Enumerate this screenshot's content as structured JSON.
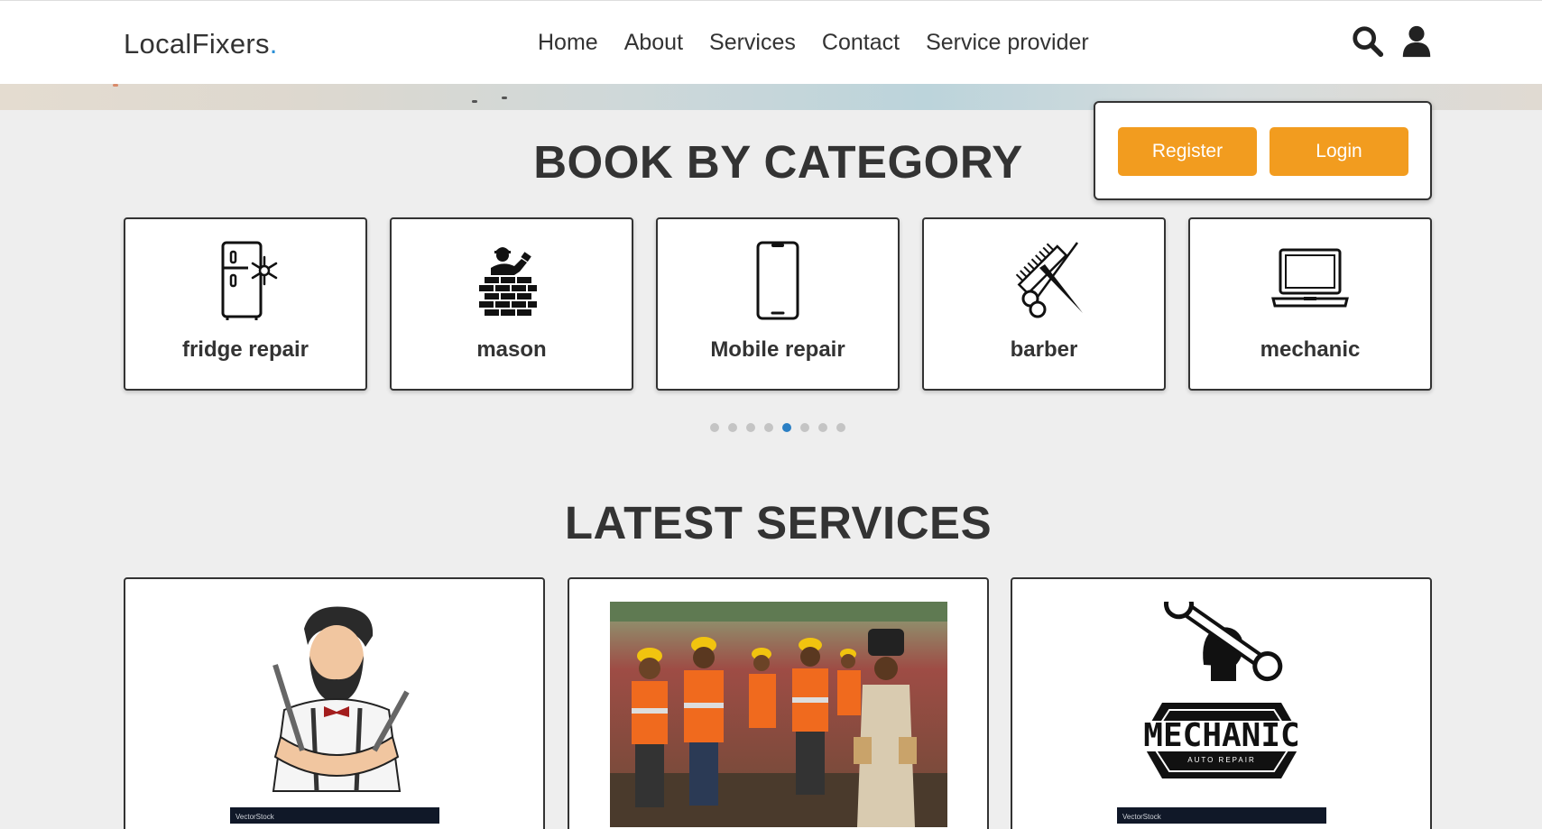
{
  "header": {
    "logo_text": "LocalFixers",
    "logo_dot": ".",
    "nav": [
      "Home",
      "About",
      "Services",
      "Contact",
      "Service provider"
    ],
    "icons": [
      "search-icon",
      "user-icon"
    ]
  },
  "auth": {
    "register_label": "Register",
    "login_label": "Login",
    "button_color": "#f29c1f"
  },
  "categories": {
    "title": "BOOK BY CATEGORY",
    "items": [
      {
        "label": "fridge repair",
        "icon": "fridge-icon"
      },
      {
        "label": "mason",
        "icon": "mason-icon"
      },
      {
        "label": "Mobile repair",
        "icon": "mobile-icon"
      },
      {
        "label": "barber",
        "icon": "barber-icon"
      },
      {
        "label": "mechanic",
        "icon": "laptop-icon"
      }
    ],
    "dots_count": 8,
    "active_dot": 5
  },
  "latest": {
    "title": "LATEST SERVICES",
    "cards": [
      {
        "image": "barber-illustration"
      },
      {
        "image": "workers-photo"
      },
      {
        "image": "mechanic-logo",
        "logo_text": "MECHANIC",
        "logo_sub": "AUTO REPAIR"
      }
    ]
  },
  "watermark": "VectorStock",
  "colors": {
    "accent_blue": "#2a7fc4",
    "orange": "#f29c1f"
  }
}
